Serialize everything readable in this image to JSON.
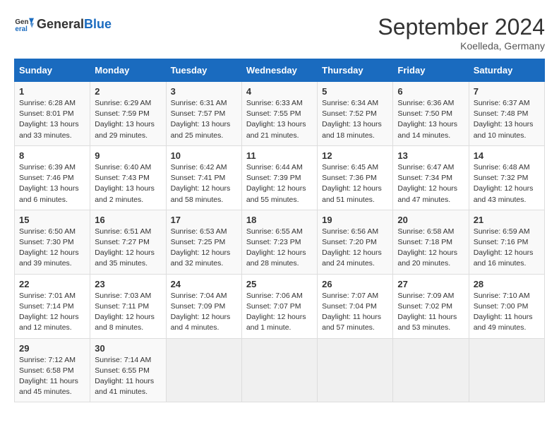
{
  "header": {
    "logo_general": "General",
    "logo_blue": "Blue",
    "month_title": "September 2024",
    "location": "Koelleda, Germany"
  },
  "days_of_week": [
    "Sunday",
    "Monday",
    "Tuesday",
    "Wednesday",
    "Thursday",
    "Friday",
    "Saturday"
  ],
  "weeks": [
    [
      {
        "day": "1",
        "sunrise": "Sunrise: 6:28 AM",
        "sunset": "Sunset: 8:01 PM",
        "daylight": "Daylight: 13 hours and 33 minutes."
      },
      {
        "day": "2",
        "sunrise": "Sunrise: 6:29 AM",
        "sunset": "Sunset: 7:59 PM",
        "daylight": "Daylight: 13 hours and 29 minutes."
      },
      {
        "day": "3",
        "sunrise": "Sunrise: 6:31 AM",
        "sunset": "Sunset: 7:57 PM",
        "daylight": "Daylight: 13 hours and 25 minutes."
      },
      {
        "day": "4",
        "sunrise": "Sunrise: 6:33 AM",
        "sunset": "Sunset: 7:55 PM",
        "daylight": "Daylight: 13 hours and 21 minutes."
      },
      {
        "day": "5",
        "sunrise": "Sunrise: 6:34 AM",
        "sunset": "Sunset: 7:52 PM",
        "daylight": "Daylight: 13 hours and 18 minutes."
      },
      {
        "day": "6",
        "sunrise": "Sunrise: 6:36 AM",
        "sunset": "Sunset: 7:50 PM",
        "daylight": "Daylight: 13 hours and 14 minutes."
      },
      {
        "day": "7",
        "sunrise": "Sunrise: 6:37 AM",
        "sunset": "Sunset: 7:48 PM",
        "daylight": "Daylight: 13 hours and 10 minutes."
      }
    ],
    [
      {
        "day": "8",
        "sunrise": "Sunrise: 6:39 AM",
        "sunset": "Sunset: 7:46 PM",
        "daylight": "Daylight: 13 hours and 6 minutes."
      },
      {
        "day": "9",
        "sunrise": "Sunrise: 6:40 AM",
        "sunset": "Sunset: 7:43 PM",
        "daylight": "Daylight: 13 hours and 2 minutes."
      },
      {
        "day": "10",
        "sunrise": "Sunrise: 6:42 AM",
        "sunset": "Sunset: 7:41 PM",
        "daylight": "Daylight: 12 hours and 58 minutes."
      },
      {
        "day": "11",
        "sunrise": "Sunrise: 6:44 AM",
        "sunset": "Sunset: 7:39 PM",
        "daylight": "Daylight: 12 hours and 55 minutes."
      },
      {
        "day": "12",
        "sunrise": "Sunrise: 6:45 AM",
        "sunset": "Sunset: 7:36 PM",
        "daylight": "Daylight: 12 hours and 51 minutes."
      },
      {
        "day": "13",
        "sunrise": "Sunrise: 6:47 AM",
        "sunset": "Sunset: 7:34 PM",
        "daylight": "Daylight: 12 hours and 47 minutes."
      },
      {
        "day": "14",
        "sunrise": "Sunrise: 6:48 AM",
        "sunset": "Sunset: 7:32 PM",
        "daylight": "Daylight: 12 hours and 43 minutes."
      }
    ],
    [
      {
        "day": "15",
        "sunrise": "Sunrise: 6:50 AM",
        "sunset": "Sunset: 7:30 PM",
        "daylight": "Daylight: 12 hours and 39 minutes."
      },
      {
        "day": "16",
        "sunrise": "Sunrise: 6:51 AM",
        "sunset": "Sunset: 7:27 PM",
        "daylight": "Daylight: 12 hours and 35 minutes."
      },
      {
        "day": "17",
        "sunrise": "Sunrise: 6:53 AM",
        "sunset": "Sunset: 7:25 PM",
        "daylight": "Daylight: 12 hours and 32 minutes."
      },
      {
        "day": "18",
        "sunrise": "Sunrise: 6:55 AM",
        "sunset": "Sunset: 7:23 PM",
        "daylight": "Daylight: 12 hours and 28 minutes."
      },
      {
        "day": "19",
        "sunrise": "Sunrise: 6:56 AM",
        "sunset": "Sunset: 7:20 PM",
        "daylight": "Daylight: 12 hours and 24 minutes."
      },
      {
        "day": "20",
        "sunrise": "Sunrise: 6:58 AM",
        "sunset": "Sunset: 7:18 PM",
        "daylight": "Daylight: 12 hours and 20 minutes."
      },
      {
        "day": "21",
        "sunrise": "Sunrise: 6:59 AM",
        "sunset": "Sunset: 7:16 PM",
        "daylight": "Daylight: 12 hours and 16 minutes."
      }
    ],
    [
      {
        "day": "22",
        "sunrise": "Sunrise: 7:01 AM",
        "sunset": "Sunset: 7:14 PM",
        "daylight": "Daylight: 12 hours and 12 minutes."
      },
      {
        "day": "23",
        "sunrise": "Sunrise: 7:03 AM",
        "sunset": "Sunset: 7:11 PM",
        "daylight": "Daylight: 12 hours and 8 minutes."
      },
      {
        "day": "24",
        "sunrise": "Sunrise: 7:04 AM",
        "sunset": "Sunset: 7:09 PM",
        "daylight": "Daylight: 12 hours and 4 minutes."
      },
      {
        "day": "25",
        "sunrise": "Sunrise: 7:06 AM",
        "sunset": "Sunset: 7:07 PM",
        "daylight": "Daylight: 12 hours and 1 minute."
      },
      {
        "day": "26",
        "sunrise": "Sunrise: 7:07 AM",
        "sunset": "Sunset: 7:04 PM",
        "daylight": "Daylight: 11 hours and 57 minutes."
      },
      {
        "day": "27",
        "sunrise": "Sunrise: 7:09 AM",
        "sunset": "Sunset: 7:02 PM",
        "daylight": "Daylight: 11 hours and 53 minutes."
      },
      {
        "day": "28",
        "sunrise": "Sunrise: 7:10 AM",
        "sunset": "Sunset: 7:00 PM",
        "daylight": "Daylight: 11 hours and 49 minutes."
      }
    ],
    [
      {
        "day": "29",
        "sunrise": "Sunrise: 7:12 AM",
        "sunset": "Sunset: 6:58 PM",
        "daylight": "Daylight: 11 hours and 45 minutes."
      },
      {
        "day": "30",
        "sunrise": "Sunrise: 7:14 AM",
        "sunset": "Sunset: 6:55 PM",
        "daylight": "Daylight: 11 hours and 41 minutes."
      },
      null,
      null,
      null,
      null,
      null
    ]
  ]
}
